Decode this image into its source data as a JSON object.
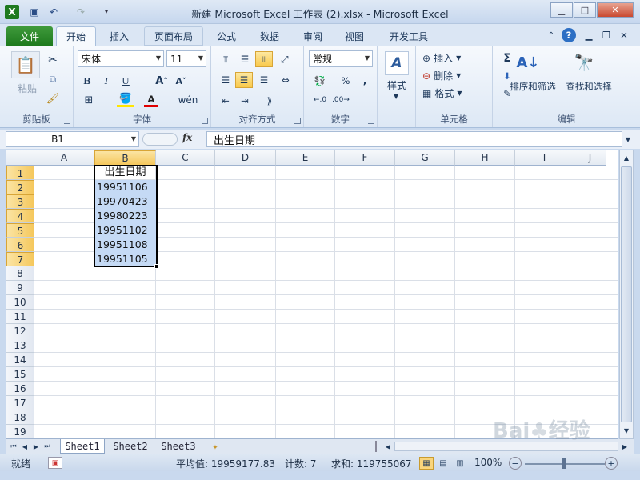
{
  "window": {
    "title": "新建 Microsoft Excel 工作表 (2).xlsx  -  Microsoft Excel",
    "app_icon": "excel-icon",
    "buttons": [
      "minimize",
      "maximize",
      "close"
    ]
  },
  "ribbon_tabs": [
    "文件",
    "开始",
    "插入",
    "页面布局",
    "公式",
    "数据",
    "审阅",
    "视图",
    "开发工具"
  ],
  "active_tab": "开始",
  "ribbon": {
    "clipboard": {
      "paste": "粘贴",
      "label": "剪贴板"
    },
    "font": {
      "name": "宋体",
      "size": "11",
      "label": "字体",
      "bold": "B",
      "italic": "I",
      "underline": "U"
    },
    "alignment": {
      "label": "对齐方式"
    },
    "number": {
      "format": "常规",
      "label": "数字"
    },
    "styles": {
      "styles": "样式"
    },
    "cells": {
      "insert": "插入",
      "delete": "删除",
      "format": "格式",
      "label": "单元格"
    },
    "editing": {
      "sum": "Σ",
      "sort_filter": "排序和筛选",
      "find_select": "查找和选择",
      "label": "编辑"
    }
  },
  "formula_bar": {
    "name_box": "B1",
    "fx": "fx",
    "content": "出生日期"
  },
  "sheet": {
    "columns": [
      "A",
      "B",
      "C",
      "D",
      "E",
      "F",
      "G",
      "H",
      "I",
      "J"
    ],
    "rows": [
      "1",
      "2",
      "3",
      "4",
      "5",
      "6",
      "7",
      "8",
      "9",
      "10",
      "11",
      "12",
      "13",
      "14",
      "15",
      "16",
      "17",
      "18",
      "19"
    ],
    "selected_column": "B",
    "selected_rows": [
      "1",
      "2",
      "3",
      "4",
      "5",
      "6",
      "7"
    ],
    "cells": {
      "B1": "出生日期",
      "B2": "19951106",
      "B3": "19970423",
      "B4": "19980223",
      "B5": "19951102",
      "B6": "19951108",
      "B7": "19951105"
    }
  },
  "sheet_tabs": [
    "Sheet1",
    "Sheet2",
    "Sheet3"
  ],
  "active_sheet": "Sheet1",
  "status": {
    "ready": "就绪",
    "average": "平均值: 19959177.83",
    "count": "计数: 7",
    "sum": "求和: 119755067",
    "zoom": "100%"
  },
  "watermark": "Baidu 经验 jingyan.baidu.com",
  "colors": {
    "file_tab": "#2a8a2a",
    "selection": "#c5daf5",
    "header_selected": "#f8d47a"
  }
}
